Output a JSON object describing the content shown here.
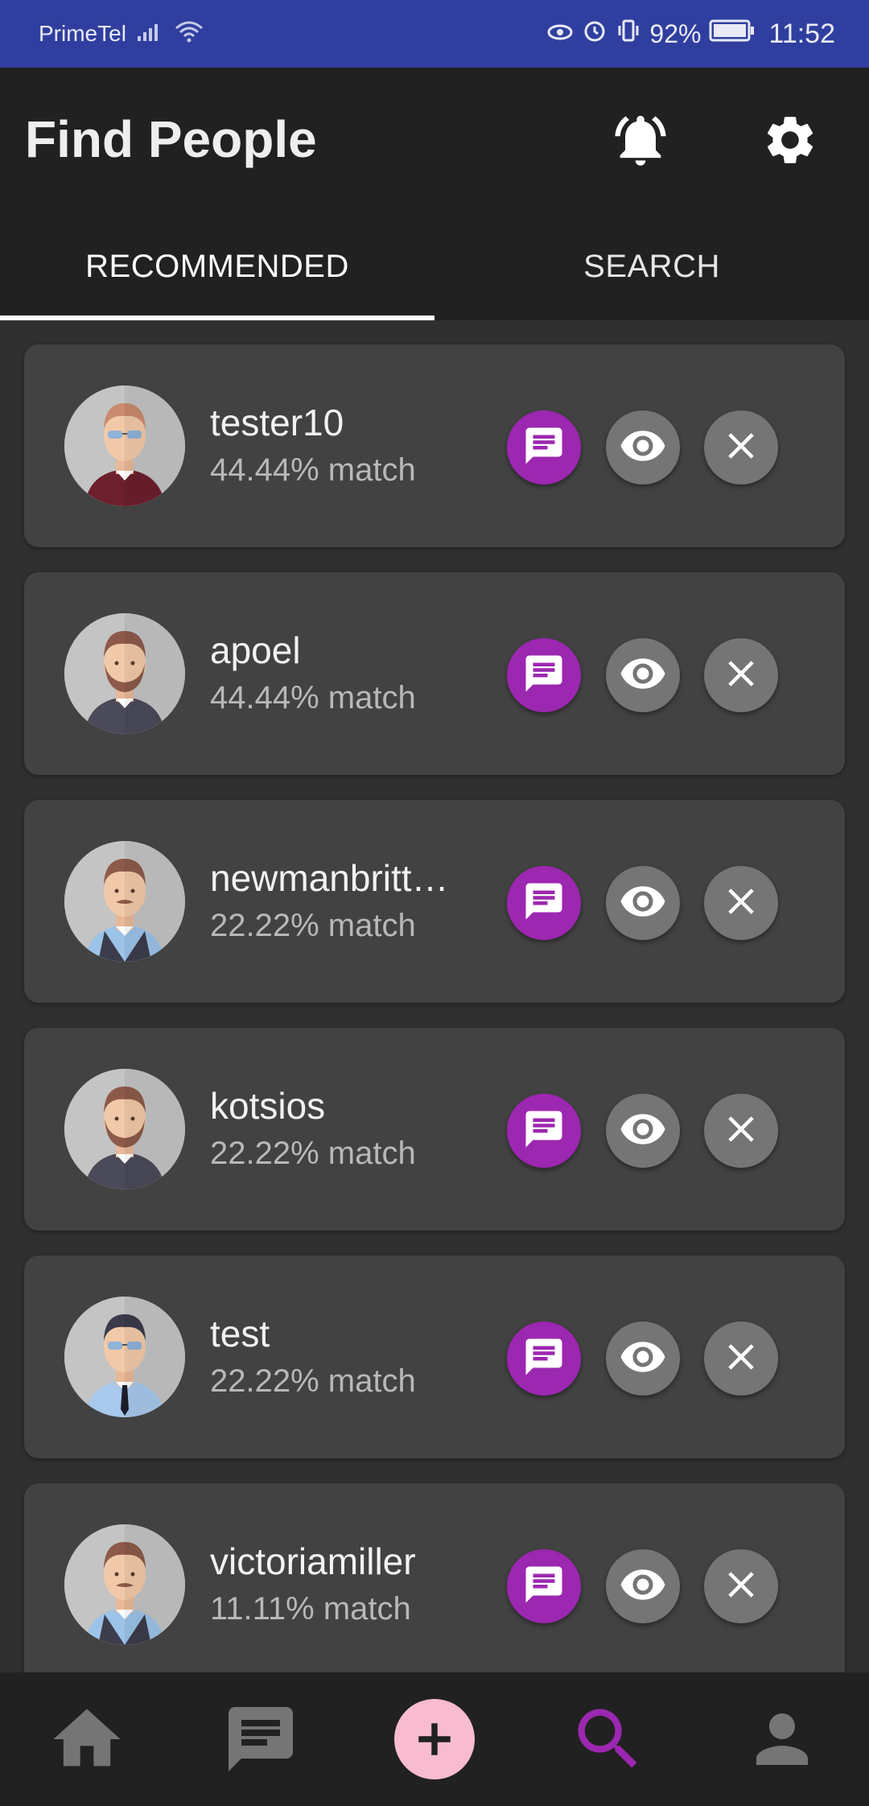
{
  "status_bar": {
    "carrier": "PrimeTel",
    "battery": "92%",
    "time": "11:52"
  },
  "header": {
    "title": "Find People"
  },
  "tabs": [
    {
      "label": "RECOMMENDED",
      "active": true
    },
    {
      "label": "SEARCH",
      "active": false
    }
  ],
  "people": [
    {
      "name": "tester10",
      "match": "44.44% match",
      "avatar": "avatar-sunglasses-maroon"
    },
    {
      "name": "apoel",
      "match": "44.44% match",
      "avatar": "avatar-beard-dark"
    },
    {
      "name": "newmanbritt…",
      "match": "22.22% match",
      "avatar": "avatar-mustache-vest"
    },
    {
      "name": "kotsios",
      "match": "22.22% match",
      "avatar": "avatar-beard-dark"
    },
    {
      "name": "test",
      "match": "22.22% match",
      "avatar": "avatar-sunglasses-tie"
    },
    {
      "name": "victoriamiller",
      "match": "11.11% match",
      "avatar": "avatar-mustache-vest"
    }
  ],
  "bottom_nav": [
    {
      "icon": "home-icon",
      "active": false
    },
    {
      "icon": "messages-icon",
      "active": false
    },
    {
      "icon": "add-icon",
      "active": false
    },
    {
      "icon": "search-icon",
      "active": true
    },
    {
      "icon": "profile-icon",
      "active": false
    }
  ],
  "colors": {
    "accent": "#9c27b0",
    "status_bar": "#303f9f",
    "fab": "#f8bbd0",
    "card": "#424242"
  }
}
